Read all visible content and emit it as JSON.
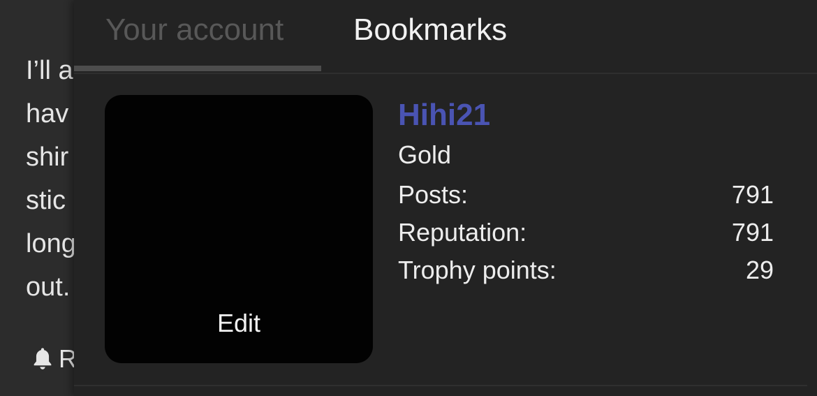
{
  "background": {
    "lines": [
      "I’ll a",
      "hav",
      "shir",
      "stic",
      "long",
      "out."
    ],
    "alert_label": "R"
  },
  "popup": {
    "tabs": [
      {
        "label": "Your account",
        "active": false
      },
      {
        "label": "Bookmarks",
        "active": true
      }
    ],
    "avatar": {
      "edit_label": "Edit"
    },
    "user": {
      "name": "Hihi21",
      "title": "Gold",
      "stats": [
        {
          "label": "Posts:",
          "value": "791"
        },
        {
          "label": "Reputation:",
          "value": "791"
        },
        {
          "label": "Trophy points:",
          "value": "29"
        }
      ]
    }
  },
  "colors": {
    "accent": "#4a54b3",
    "panel_bg": "#232323",
    "page_bg": "#2c2c2c"
  },
  "icons": {
    "alert": "bell-icon"
  }
}
